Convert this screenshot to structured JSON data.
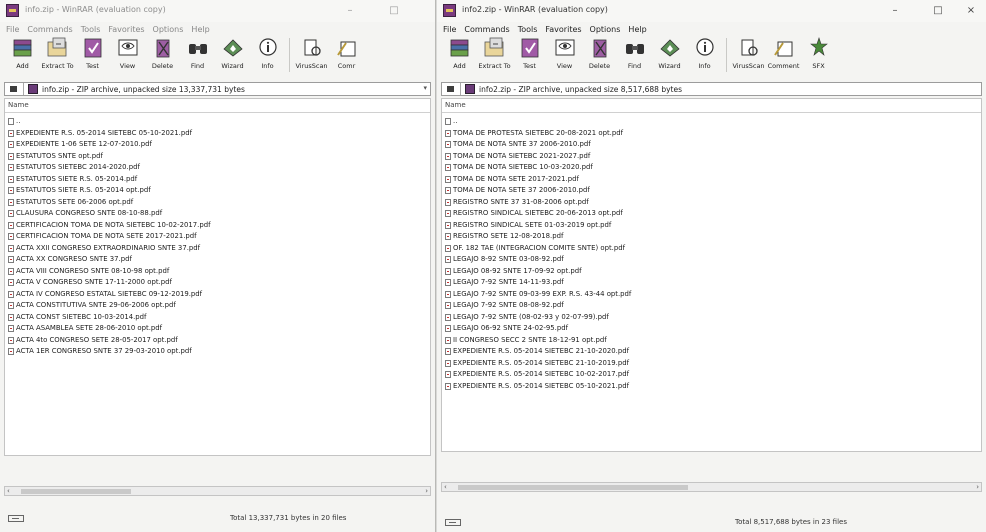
{
  "left": {
    "title": "info.zip - WinRAR (evaluation copy)",
    "window_controls": [
      "–",
      "□"
    ],
    "menu": [
      "File",
      "Commands",
      "Tools",
      "Favorites",
      "Options",
      "Help"
    ],
    "toolbar": [
      {
        "label": "Add",
        "icon": "add-icon"
      },
      {
        "label": "Extract To",
        "icon": "extract-icon"
      },
      {
        "label": "Test",
        "icon": "test-icon"
      },
      {
        "label": "View",
        "icon": "view-icon"
      },
      {
        "label": "Delete",
        "icon": "delete-icon"
      },
      {
        "label": "Find",
        "icon": "find-icon"
      },
      {
        "label": "Wizard",
        "icon": "wizard-icon"
      },
      {
        "label": "Info",
        "icon": "info-icon"
      },
      {
        "label": "VirusScan",
        "icon": "virusscan-icon"
      },
      {
        "label": "Comr",
        "icon": "comment-icon"
      }
    ],
    "address": "info.zip - ZIP archive, unpacked size 13,337,731 bytes",
    "column_name": "Name",
    "up_entry": "..",
    "files": [
      "EXPEDIENTE R.S. 05-2014 SIETEBC 05-10-2021.pdf",
      "EXPEDIENTE 1-06 SETE 12-07-2010.pdf",
      "ESTATUTOS SNTE opt.pdf",
      "ESTATUTOS SIETEBC 2014-2020.pdf",
      "ESTATUTOS SIETE R.S. 05-2014.pdf",
      "ESTATUTOS SIETE R.S. 05-2014 opt.pdf",
      "ESTATUTOS SETE 06-2006 opt.pdf",
      "CLAUSURA CONGRESO SNTE 08-10-88.pdf",
      "CERTIFICACION TOMA DE NOTA SIETEBC 10-02-2017.pdf",
      "CERTIFICACION TOMA DE NOTA SETE 2017-2021.pdf",
      "ACTA XXII CONGRESO EXTRAORDINARIO SNTE 37.pdf",
      "ACTA XX CONGRESO SNTE 37.pdf",
      "ACTA VIII CONGRESO SNTE 08-10-98 opt.pdf",
      "ACTA V CONGRESO SNTE 17-11-2000 opt.pdf",
      "ACTA IV CONGRESO ESTATAL SIETEBC 09-12-2019.pdf",
      "ACTA CONSTITUTIVA SNTE 29-06-2006 opt.pdf",
      "ACTA CONST SIETEBC 10-03-2014.pdf",
      "ACTA ASAMBLEA SETE 28-06-2010 opt.pdf",
      "ACTA 4to CONGRESO SETE 28-05-2017 opt.pdf",
      "ACTA 1ER CONGRESO SNTE 37 29-03-2010 opt.pdf"
    ],
    "status": "Total 13,337,731 bytes in 20 files"
  },
  "right": {
    "title": "info2.zip - WinRAR (evaluation copy)",
    "window_controls": [
      "–",
      "□",
      "×"
    ],
    "menu": [
      "File",
      "Commands",
      "Tools",
      "Favorites",
      "Options",
      "Help"
    ],
    "toolbar": [
      {
        "label": "Add",
        "icon": "add-icon"
      },
      {
        "label": "Extract To",
        "icon": "extract-icon"
      },
      {
        "label": "Test",
        "icon": "test-icon"
      },
      {
        "label": "View",
        "icon": "view-icon"
      },
      {
        "label": "Delete",
        "icon": "delete-icon"
      },
      {
        "label": "Find",
        "icon": "find-icon"
      },
      {
        "label": "Wizard",
        "icon": "wizard-icon"
      },
      {
        "label": "Info",
        "icon": "info-icon"
      },
      {
        "label": "VirusScan",
        "icon": "virusscan-icon"
      },
      {
        "label": "Comment",
        "icon": "comment-icon"
      },
      {
        "label": "SFX",
        "icon": "sfx-icon"
      }
    ],
    "address": "info2.zip - ZIP archive, unpacked size 8,517,688 bytes",
    "column_name": "Name",
    "up_entry": "..",
    "files": [
      "TOMA DE PROTESTA SIETEBC 20-08-2021 opt.pdf",
      "TOMA DE NOTA SNTE 37 2006-2010.pdf",
      "TOMA DE NOTA SIETEBC 2021-2027.pdf",
      "TOMA DE NOTA SIETEBC 10-03-2020.pdf",
      "TOMA DE NOTA SETE 2017-2021.pdf",
      "TOMA DE NOTA SETE 37 2006-2010.pdf",
      "REGISTRO SNTE 37 31-08-2006 opt.pdf",
      "REGISTRO SINDICAL SIETEBC 20-06-2013 opt.pdf",
      "REGISTRO SINDICAL SETE 01-03-2019 opt.pdf",
      "REGISTRO SETE 12-08-2018.pdf",
      "OF. 182 TAE (INTEGRACION COMITE SNTE) opt.pdf",
      "LEGAJO 8-92 SNTE 03-08-92.pdf",
      "LEGAJO 08-92 SNTE 17-09-92 opt.pdf",
      "LEGAJO 7-92 SNTE 14-11-93.pdf",
      "LEGAJO 7-92 SNTE 09-03-99 EXP. R.S. 43-44 opt.pdf",
      "LEGAJO 7-92 SNTE 08-08-92.pdf",
      "LEGAJO 7-92 SNTE (08-02-93 y 02-07-99).pdf",
      "LEGAJO 06-92 SNTE 24-02-95.pdf",
      "II CONGRESO SECC 2 SNTE 18-12-91 opt.pdf",
      "EXPEDIENTE R.S. 05-2014 SIETEBC 21-10-2020.pdf",
      "EXPEDIENTE R.S. 05-2014 SIETEBC 21-10-2019.pdf",
      "EXPEDIENTE R.S. 05-2014 SIETEBC 10-02-2017.pdf",
      "EXPEDIENTE R.S. 05-2014 SIETEBC 05-10-2021.pdf"
    ],
    "status": "Total 8,517,688 bytes in 23 files"
  }
}
